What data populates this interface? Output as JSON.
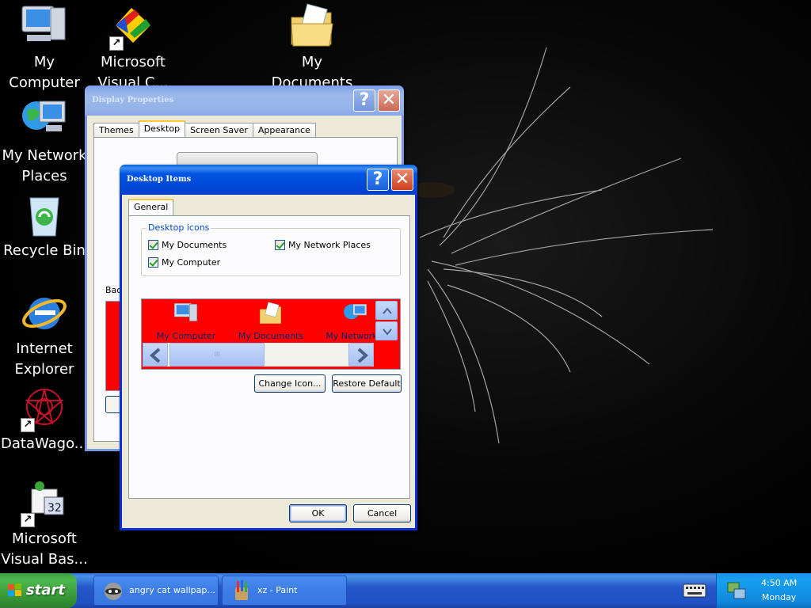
{
  "desktop": {
    "icons": [
      {
        "label": "My\nComputer"
      },
      {
        "label": "Microsoft\nVisual C..."
      },
      {
        "label": "My\nDocuments"
      },
      {
        "label": "My Network\nPlaces"
      },
      {
        "label": "Recycle Bin"
      },
      {
        "label": "Internet\nExplorer"
      },
      {
        "label": "DataWago..."
      },
      {
        "label": "Microsoft\nVisual Bas..."
      }
    ]
  },
  "display_properties": {
    "title": "Display Properties",
    "tabs": [
      "Themes",
      "Desktop",
      "Screen Saver",
      "Appearance"
    ],
    "active_tab": "Desktop",
    "background_label": "Back",
    "help_glyph": "?",
    "close_glyph": "✕"
  },
  "desktop_items": {
    "title": "Desktop Items",
    "tab": "General",
    "group_title": "Desktop icons",
    "checkboxes": [
      {
        "label": "My Documents",
        "checked": true
      },
      {
        "label": "My Network Places",
        "checked": true
      },
      {
        "label": "My Computer",
        "checked": true
      }
    ],
    "icon_list": [
      "My Computer",
      "My Documents",
      "My Network P"
    ],
    "scroll_thumb": "III",
    "change_icon": "Change Icon...",
    "restore_default": "Restore Default",
    "ok": "OK",
    "cancel": "Cancel",
    "help_glyph": "?",
    "close_glyph": "✕",
    "icon_strip_color": "#ff0000"
  },
  "taskbar": {
    "start": "start",
    "items": [
      {
        "label": "angry cat wallpap..."
      },
      {
        "label": "xz - Paint"
      }
    ],
    "time": "4:50 AM",
    "day": "Monday"
  }
}
